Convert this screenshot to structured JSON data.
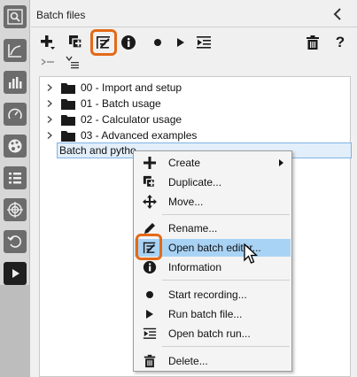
{
  "panel": {
    "title": "Batch files",
    "collapse_icon": "chevron-left-icon"
  },
  "toolbar": {
    "row1": [
      {
        "name": "create-dropdown-button",
        "icon": "plus-dropdown-icon"
      },
      {
        "name": "duplicate-button",
        "icon": "duplicate-icon"
      },
      {
        "name": "open-batch-editor-button",
        "icon": "batch-editor-icon",
        "highlighted": true
      },
      {
        "name": "information-button",
        "icon": "info-icon"
      },
      {
        "name": "start-recording-button",
        "icon": "record-dot-icon"
      },
      {
        "name": "run-batch-file-button",
        "icon": "play-icon"
      },
      {
        "name": "open-batch-run-button",
        "icon": "batch-run-icon"
      },
      {
        "name": "delete-button",
        "icon": "trash-icon"
      },
      {
        "name": "help-button",
        "icon": "help-icon",
        "label": "?"
      }
    ],
    "row2": [
      {
        "name": "expand-tree-button",
        "icon": "expand-tree-icon"
      },
      {
        "name": "sort-tree-button",
        "icon": "sort-tree-icon"
      }
    ]
  },
  "tree": {
    "items": [
      {
        "label": "00 - Import and setup",
        "type": "folder"
      },
      {
        "label": "01 - Batch usage",
        "type": "folder"
      },
      {
        "label": "02 - Calculator usage",
        "type": "folder"
      },
      {
        "label": "03 - Advanced examples",
        "type": "folder"
      }
    ],
    "selected_item": {
      "label": "Batch and pytho"
    }
  },
  "context_menu": {
    "items": [
      {
        "label": "Create",
        "icon": "plus-icon",
        "has_submenu": true
      },
      {
        "label": "Duplicate...",
        "icon": "duplicate-icon"
      },
      {
        "label": "Move...",
        "icon": "move-arrows-icon"
      },
      {
        "label": "Rename...",
        "icon": "pencil-icon"
      },
      {
        "label": "Open batch editor...",
        "icon": "batch-editor-icon",
        "hovered": true
      },
      {
        "label": "Information",
        "icon": "info-icon"
      },
      {
        "label": "Start recording...",
        "icon": "record-dot-icon"
      },
      {
        "label": "Run batch file...",
        "icon": "play-icon"
      },
      {
        "label": "Open batch run...",
        "icon": "batch-run-icon"
      },
      {
        "label": "Delete...",
        "icon": "trash-icon"
      }
    ]
  },
  "leftbar": {
    "icons": [
      "quick-search-icon",
      "chart-line-icon",
      "distribution-icon",
      "gauge-icon",
      "palette-icon",
      "list-icon",
      "target-icon",
      "undo-history-icon",
      "batch-play-icon"
    ]
  },
  "colors": {
    "highlight": "#e36a17",
    "menu_hover": "#a9d3f5",
    "selection_bg": "#e2eef9",
    "selection_border": "#7fb2e6"
  }
}
